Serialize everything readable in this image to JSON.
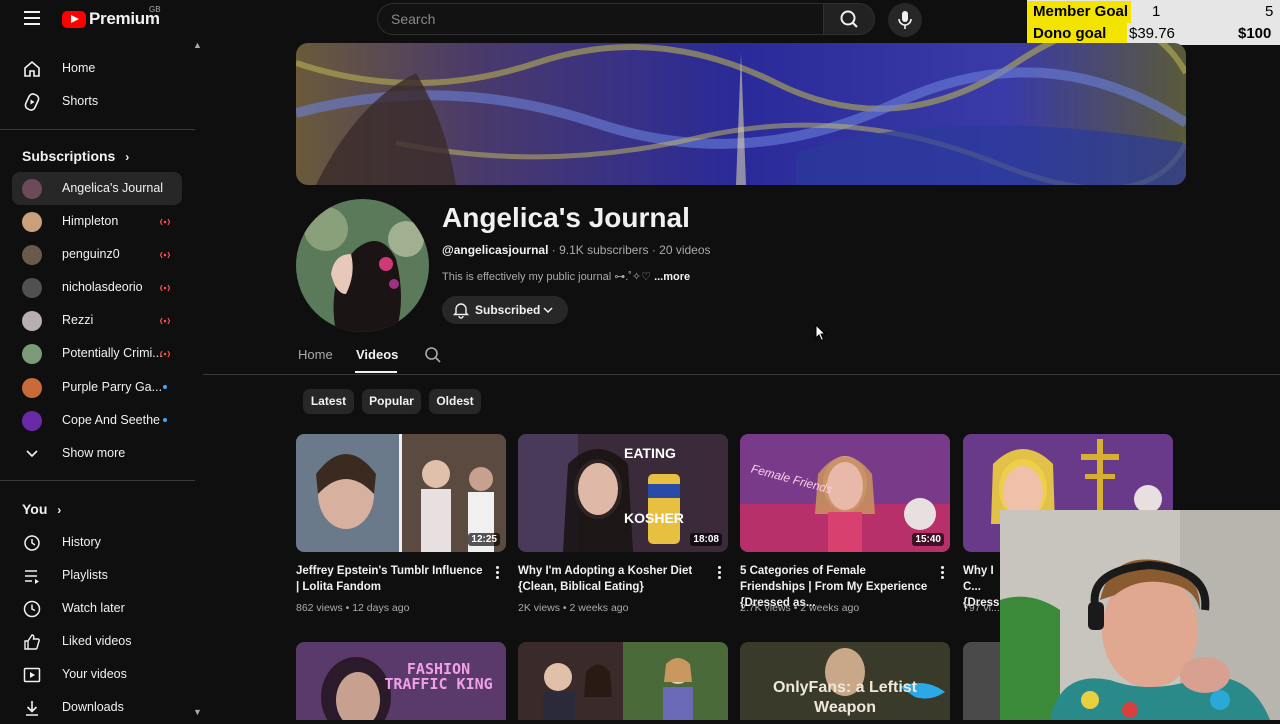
{
  "header": {
    "logo_text": "Premium",
    "logo_region": "GB",
    "search_placeholder": "Search"
  },
  "overlay": {
    "member_goal_label": "Member Goal",
    "member_goal_current": "1",
    "member_goal_target": "5",
    "dono_goal_label": "Dono goal",
    "dono_goal_current": "$39.76",
    "dono_goal_target": "$100"
  },
  "sidebar": {
    "main": [
      {
        "label": "Home",
        "icon": "home-icon"
      },
      {
        "label": "Shorts",
        "icon": "shorts-icon"
      }
    ],
    "subscriptions_title": "Subscriptions",
    "subscriptions": [
      {
        "label": "Angelica's Journal",
        "status": "active",
        "color": "#6b4a5a"
      },
      {
        "label": "Himpleton",
        "status": "live",
        "color": "#c9a07a"
      },
      {
        "label": "penguinz0",
        "status": "live",
        "color": "#6a5a4a"
      },
      {
        "label": "nicholasdeorio",
        "status": "live",
        "color": "#505050"
      },
      {
        "label": "Rezzi",
        "status": "live",
        "color": "#b8b0b0"
      },
      {
        "label": "Potentially Crimi...",
        "status": "live",
        "color": "#7a9a7a"
      },
      {
        "label": "Purple Parry Ga...",
        "status": "new",
        "color": "#c86a3a"
      },
      {
        "label": "Cope And Seethe",
        "status": "new",
        "color": "#6a2aa8"
      }
    ],
    "show_more": "Show more",
    "you_title": "You",
    "you_items": [
      {
        "label": "History",
        "icon": "history-icon"
      },
      {
        "label": "Playlists",
        "icon": "playlists-icon"
      },
      {
        "label": "Watch later",
        "icon": "watch-later-icon"
      },
      {
        "label": "Liked videos",
        "icon": "like-icon"
      },
      {
        "label": "Your videos",
        "icon": "your-videos-icon"
      },
      {
        "label": "Downloads",
        "icon": "download-icon"
      }
    ]
  },
  "channel": {
    "name": "Angelica's Journal",
    "handle": "@angelicasjournal",
    "subscribers": "9.1K subscribers",
    "videos_count": "20 videos",
    "sep": "·",
    "description": "This is effectively my public journal ⊶.˚✧♡",
    "more": "...more",
    "subscribe_label": "Subscribed"
  },
  "tabs": [
    "Home",
    "Videos"
  ],
  "chips": [
    "Latest",
    "Popular",
    "Oldest"
  ],
  "videos": [
    {
      "title": "Jeffrey Epstein's Tumblr Influence | Lolita Fandom",
      "meta": "862 views • 12 days ago",
      "duration": "12:25"
    },
    {
      "title": "Why I'm Adopting a Kosher Diet {Clean, Biblical Eating}",
      "meta": "2K views • 2 weeks ago",
      "duration": "18:08",
      "overlay_top": "EATING",
      "overlay_bottom": "KOSHER"
    },
    {
      "title": "5 Categories of Female Friendships | From My Experience {Dressed as...",
      "meta": "2.7K views • 2 weeks ago",
      "duration": "15:40",
      "overlay_text": "Female Friends"
    },
    {
      "title": "Why I C... {Dresse...",
      "meta": "797 vi...",
      "duration": ""
    }
  ],
  "row2": [
    {
      "overlay_text": "FASHION TRAFFIC KING"
    },
    {
      "overlay_text": ""
    },
    {
      "overlay_text": "OnlyFans: a Leftist Weapon"
    },
    {
      "overlay_text": ""
    }
  ]
}
